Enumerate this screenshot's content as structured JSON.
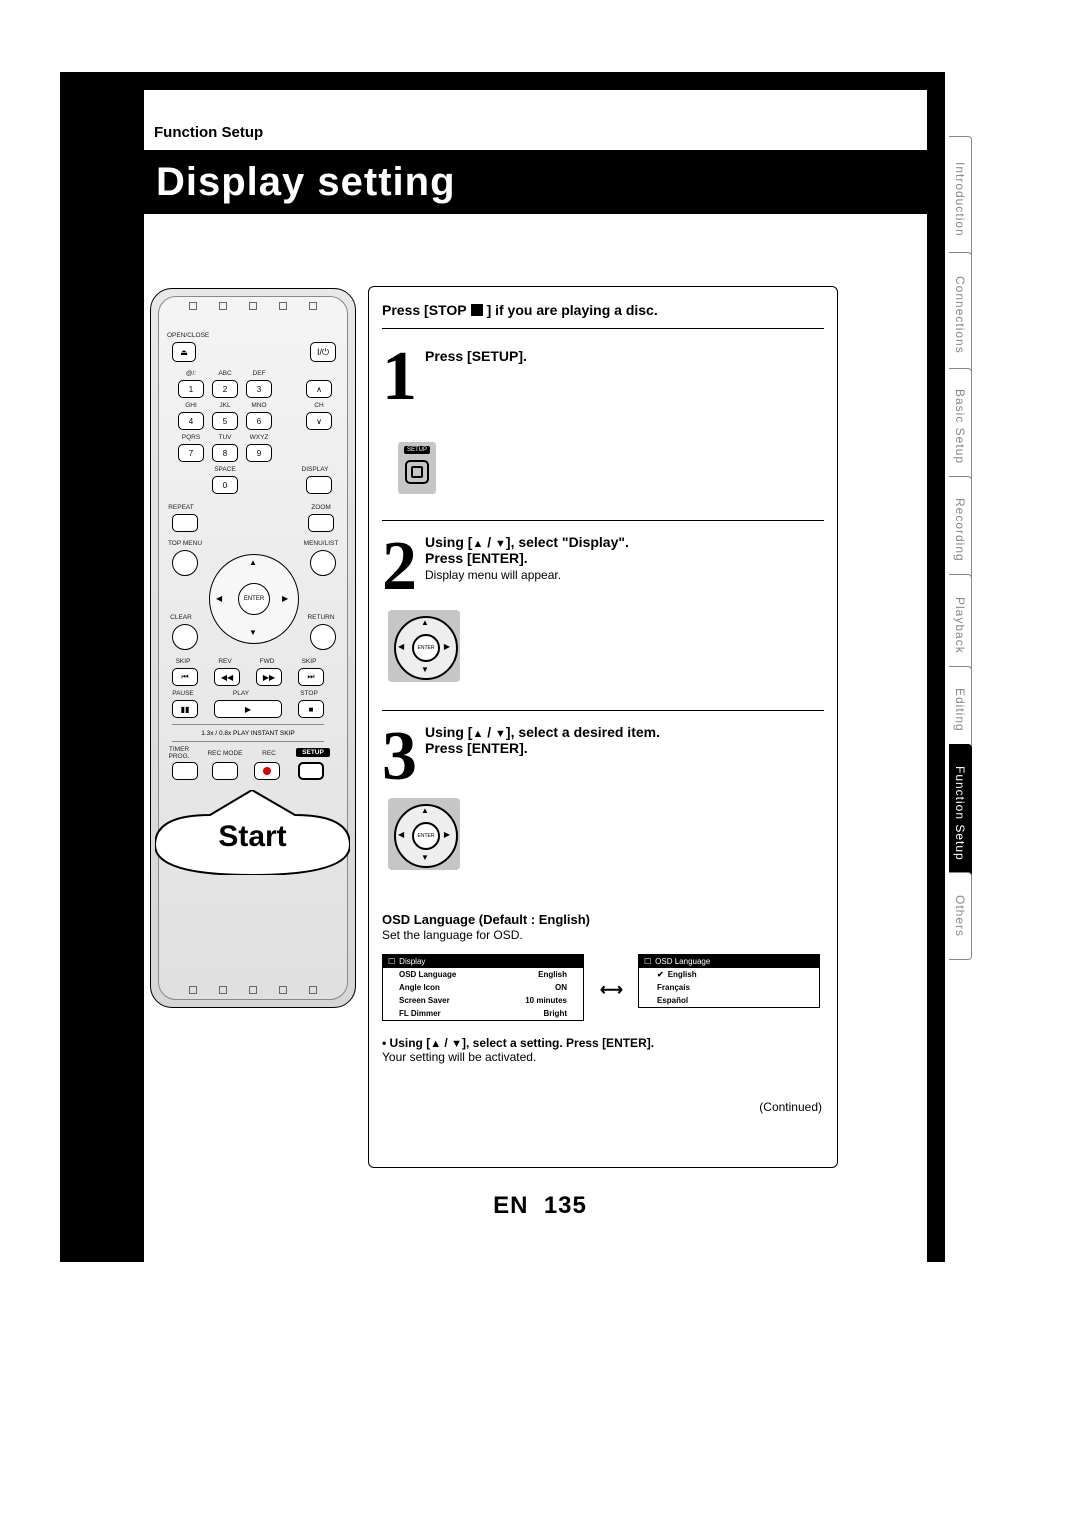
{
  "header": {
    "section": "Function Setup",
    "title": "Display setting"
  },
  "remote": {
    "open_close": "OPEN/CLOSE",
    "power_sym": "I/⏻",
    "key_labels_top": [
      "@/:",
      "ABC",
      "DEF"
    ],
    "keys_r1": [
      "1",
      "2",
      "3"
    ],
    "key_labels_r2": [
      "GHI",
      "JKL",
      "MNO"
    ],
    "keys_r2": [
      "4",
      "5",
      "6"
    ],
    "key_labels_r3": [
      "PQRS",
      "TUV",
      "WXYZ"
    ],
    "keys_r3": [
      "7",
      "8",
      "9"
    ],
    "space": "SPACE",
    "zero": "0",
    "ch": "CH",
    "display": "DISPLAY",
    "repeat": "REPEAT",
    "zoom": "ZOOM",
    "top_menu": "TOP MENU",
    "menu_list": "MENU/LIST",
    "enter": "ENTER",
    "clear": "CLEAR",
    "return": "RETURN",
    "transport_labels": [
      "SKIP",
      "REV",
      "FWD",
      "SKIP"
    ],
    "transport2_labels": [
      "PAUSE",
      "PLAY",
      "STOP"
    ],
    "strip": "1.3x / 0.8x PLAY   INSTANT SKIP",
    "bottom_labels": [
      "TIMER\nPROG.",
      "REC MODE",
      "REC",
      "SETUP"
    ],
    "setup": "SETUP"
  },
  "bubble": "Start",
  "instr": {
    "top_pre": "Press [STOP ",
    "top_post": "] if you are playing a disc.",
    "step1": "Press [SETUP].",
    "step2_a": "Using [",
    "step2_b": " / ",
    "step2_c": "], select \"Display\".",
    "step2_d": "Press [ENTER].",
    "step2_note": "Display menu will appear.",
    "step3_a": "Using [",
    "step3_b": " / ",
    "step3_c": "], select a desired item.",
    "step3_d": "Press [ENTER].",
    "osd_heading": "OSD Language (Default : English)",
    "osd_sub": "Set the language for OSD.",
    "menu1_title": "Display",
    "menu1_rows": [
      {
        "l": "OSD Language",
        "r": "English"
      },
      {
        "l": "Angle Icon",
        "r": "ON"
      },
      {
        "l": "Screen Saver",
        "r": "10 minutes"
      },
      {
        "l": "FL Dimmer",
        "r": "Bright"
      }
    ],
    "menu2_title": "OSD Language",
    "menu2_rows": [
      "English",
      "Français",
      "Español"
    ],
    "using_line_a": "• Using [",
    "using_line_b": " / ",
    "using_line_c": "], select a setting. Press [ENTER].",
    "activated": "Your setting will be activated.",
    "continued": "(Continued)",
    "setup_micro": "SETUP",
    "enter_micro": "ENTER"
  },
  "footer": {
    "lang": "EN",
    "page": "135"
  },
  "tabs": [
    "Introduction",
    "Connections",
    "Basic Setup",
    "Recording",
    "Playback",
    "Editing",
    "Function Setup",
    "Others"
  ],
  "active_tab": 6
}
